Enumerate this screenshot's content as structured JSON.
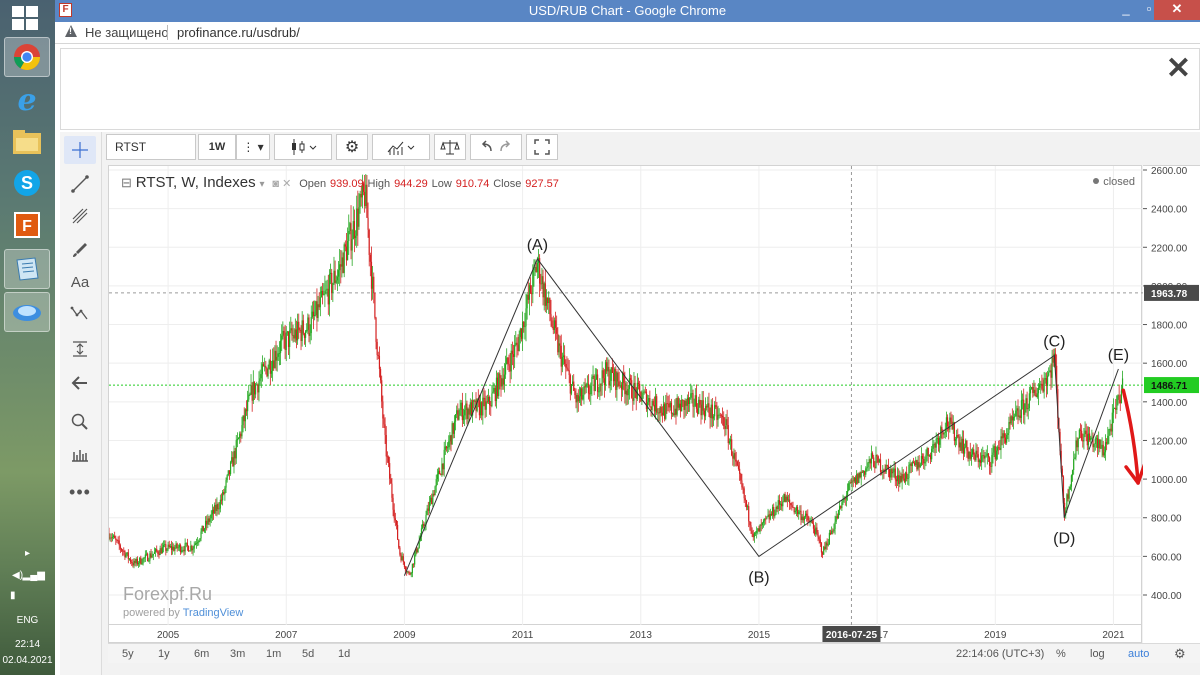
{
  "taskbar": {
    "language": "ENG",
    "time": "22:14",
    "date": "02.04.2021"
  },
  "window": {
    "title": "USD/RUB Chart - Google Chrome",
    "minimize": "_",
    "maximize": "▫",
    "close": "✕"
  },
  "address": {
    "security_text": "Не защищено",
    "url": "profinance.ru/usdrub/"
  },
  "ad": {
    "close_glyph": "✕"
  },
  "toolbar": {
    "symbol": "RTST",
    "interval": "1W"
  },
  "legend": {
    "symbol_text": "RTST, W, Indexes",
    "open_label": "Open",
    "open_value": "939.09",
    "high_label": "High",
    "high_value": "944.29",
    "low_label": "Low",
    "low_value": "910.74",
    "close_label": "Close",
    "close_value": "927.57",
    "status": "closed"
  },
  "watermark": {
    "brand": "Forexpf.Ru",
    "powered_prefix": "powered by ",
    "powered_name": "TradingView"
  },
  "crosshair_date": "2016-07-25",
  "price_labels": {
    "crosshair": "1963.78",
    "last": "1486.71"
  },
  "bottom": {
    "ranges": [
      "5y",
      "1y",
      "6m",
      "3m",
      "1m",
      "5d",
      "1d"
    ],
    "clock": "22:14:06 (UTC+3)",
    "percent": "%",
    "log": "log",
    "auto": "auto"
  },
  "colors": {
    "up": "#26a822",
    "down": "#d42020",
    "wave_line": "#333333",
    "last_price_line": "#22cc22",
    "arrow": "#e01818"
  },
  "chart_data": {
    "type": "candlestick",
    "title": "RTST, W, Indexes",
    "x_axis": {
      "type": "date",
      "range": [
        "2004-01",
        "2021-07"
      ],
      "tick_labels": [
        "2005",
        "2007",
        "2009",
        "2011",
        "2013",
        "2015",
        "2017",
        "2019",
        "2021"
      ]
    },
    "y_axis": {
      "range": [
        400,
        2600
      ],
      "tick_labels": [
        "400.00",
        "600.00",
        "800.00",
        "1000.00",
        "1200.00",
        "1400.00",
        "1600.00",
        "1800.00",
        "2000.00",
        "2200.00",
        "2400.00",
        "2600.00"
      ]
    },
    "close_series": [
      [
        "2004-01",
        720
      ],
      [
        "2004-06",
        560
      ],
      [
        "2004-12",
        640
      ],
      [
        "2005-06",
        650
      ],
      [
        "2005-12",
        900
      ],
      [
        "2006-06",
        1450
      ],
      [
        "2006-12",
        1700
      ],
      [
        "2007-06",
        1800
      ],
      [
        "2007-12",
        2100
      ],
      [
        "2008-05",
        2480
      ],
      [
        "2008-09",
        1200
      ],
      [
        "2008-12",
        620
      ],
      [
        "2009-02",
        500
      ],
      [
        "2009-06",
        860
      ],
      [
        "2009-12",
        1350
      ],
      [
        "2010-06",
        1380
      ],
      [
        "2010-12",
        1700
      ],
      [
        "2011-04",
        2120
      ],
      [
        "2011-08",
        1700
      ],
      [
        "2011-12",
        1400
      ],
      [
        "2012-06",
        1550
      ],
      [
        "2012-12",
        1450
      ],
      [
        "2013-06",
        1350
      ],
      [
        "2013-12",
        1400
      ],
      [
        "2014-06",
        1300
      ],
      [
        "2014-12",
        700
      ],
      [
        "2015-06",
        900
      ],
      [
        "2015-12",
        760
      ],
      [
        "2016-02",
        620
      ],
      [
        "2016-07",
        940
      ],
      [
        "2016-12",
        1100
      ],
      [
        "2017-06",
        1000
      ],
      [
        "2017-12",
        1150
      ],
      [
        "2018-03",
        1300
      ],
      [
        "2018-08",
        1120
      ],
      [
        "2018-12",
        1100
      ],
      [
        "2019-06",
        1350
      ],
      [
        "2019-12",
        1550
      ],
      [
        "2020-01",
        1640
      ],
      [
        "2020-03",
        820
      ],
      [
        "2020-06",
        1250
      ],
      [
        "2020-11",
        1150
      ],
      [
        "2021-03",
        1490
      ]
    ],
    "wave_points": [
      {
        "label": "",
        "date": "2009-01",
        "value": 500
      },
      {
        "label": "(A)",
        "date": "2011-04",
        "value": 2140
      },
      {
        "label": "(B)",
        "date": "2015-01",
        "value": 600
      },
      {
        "label": "(C)",
        "date": "2020-01",
        "value": 1640
      },
      {
        "label": "(D)",
        "date": "2020-03",
        "value": 800
      },
      {
        "label": "(E)",
        "date": "2021-02",
        "value": 1570
      }
    ],
    "horizontal_lines": [
      {
        "value": 1963.78,
        "style": "dashed"
      },
      {
        "value": 1486.71,
        "style": "dotted-green"
      }
    ],
    "projection_arrow": {
      "from": [
        "2021-03",
        1460
      ],
      "to": [
        "2021-06",
        980
      ]
    }
  }
}
